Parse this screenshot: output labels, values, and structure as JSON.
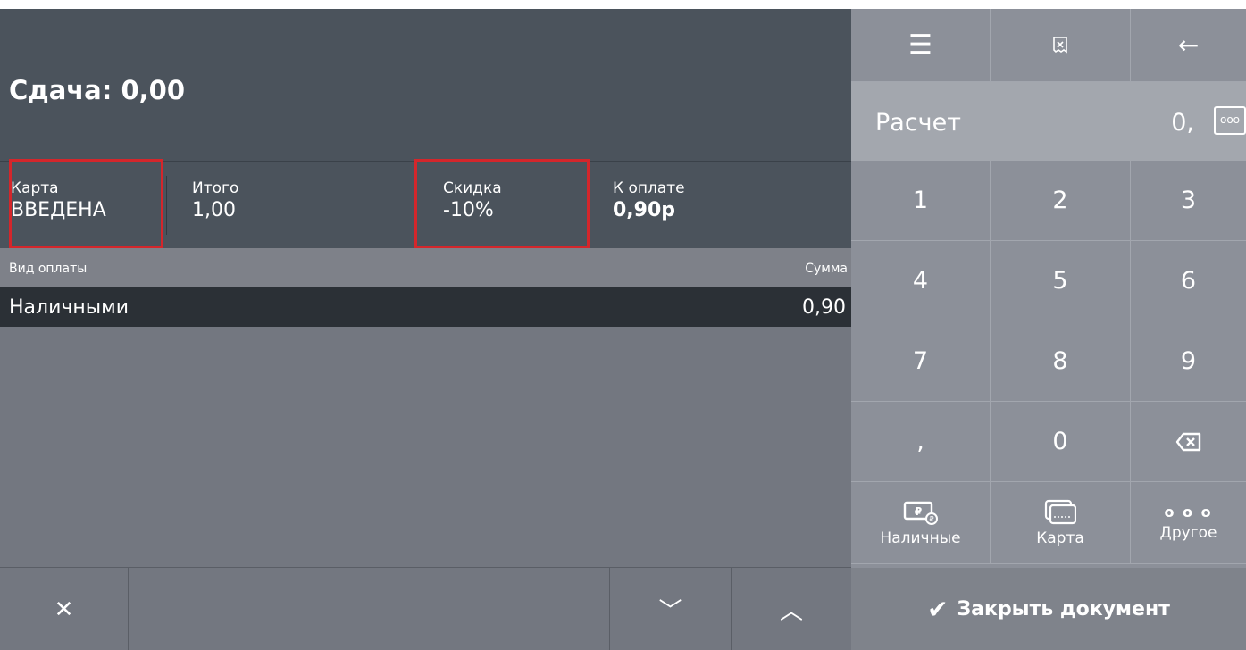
{
  "header": {
    "change": "Сдача: 0,00"
  },
  "info": {
    "card": {
      "label": "Карта",
      "value": "ВВЕДЕНА"
    },
    "total": {
      "label": "Итого",
      "value": "1,00"
    },
    "discount": {
      "label": "Скидка",
      "value": "-10%"
    },
    "to_pay": {
      "label": "К оплате",
      "value": "0,90р"
    }
  },
  "table": {
    "columns": [
      "Вид оплаты",
      "Сумма"
    ],
    "rows": [
      {
        "type": "Наличными",
        "amount": "0,90"
      }
    ]
  },
  "bottom": {
    "close_glyph": "✕",
    "down_glyph": "﹀",
    "up_glyph": "︿"
  },
  "keypad": {
    "menu_glyph": "☰",
    "back_glyph": "←",
    "display_title": "Расчет",
    "display_value": "0,",
    "display_more": "ooo",
    "keys": [
      "1",
      "2",
      "3",
      "4",
      "5",
      "6",
      "7",
      "8",
      "9",
      ",",
      "0"
    ],
    "payment_buttons": [
      "Наличные",
      "Карта",
      "Другое"
    ],
    "other_glyph": "o o o",
    "close_document": "Закрыть документ",
    "check_glyph": "✔"
  },
  "colors": {
    "highlight": "#d4262b",
    "header_bg": "#4b535c",
    "keypad_bg": "#8c9099"
  }
}
